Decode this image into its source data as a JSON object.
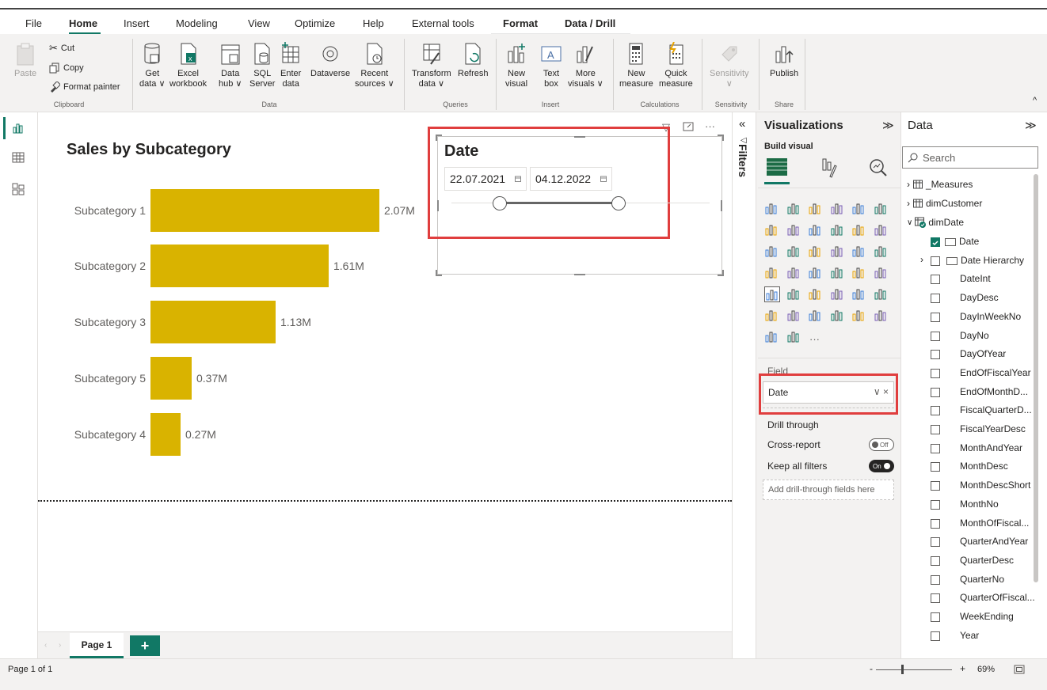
{
  "menu": {
    "tabs": [
      "File",
      "Home",
      "Insert",
      "Modeling",
      "View",
      "Optimize",
      "Help",
      "External tools",
      "Format",
      "Data / Drill"
    ],
    "active": "Home"
  },
  "ribbon": {
    "clipboard": {
      "paste": "Paste",
      "cut": "Cut",
      "copy": "Copy",
      "format_painter": "Format painter",
      "group": "Clipboard"
    },
    "data": {
      "get_data": [
        "Get",
        "data ∨"
      ],
      "excel": [
        "Excel",
        "workbook"
      ],
      "data_hub": [
        "Data",
        "hub ∨"
      ],
      "sql": [
        "SQL",
        "Server"
      ],
      "enter": [
        "Enter",
        "data"
      ],
      "dataverse": "Dataverse",
      "recent": [
        "Recent",
        "sources ∨"
      ],
      "group": "Data"
    },
    "queries": {
      "transform": [
        "Transform",
        "data ∨"
      ],
      "refresh": "Refresh",
      "group": "Queries"
    },
    "insert": {
      "new_visual": [
        "New",
        "visual"
      ],
      "text_box": [
        "Text",
        "box"
      ],
      "more_visuals": [
        "More",
        "visuals ∨"
      ],
      "group": "Insert"
    },
    "calculations": {
      "new_measure": [
        "New",
        "measure"
      ],
      "quick_measure": [
        "Quick",
        "measure"
      ],
      "group": "Calculations"
    },
    "sensitivity": {
      "label": "Sensitivity",
      "chev": "∨",
      "group": "Sensitivity"
    },
    "share": {
      "publish": "Publish",
      "group": "Share"
    }
  },
  "chart_data": {
    "type": "bar",
    "title": "Sales by Subcategory",
    "categories": [
      "Subcategory 1",
      "Subcategory 2",
      "Subcategory 3",
      "Subcategory 5",
      "Subcategory 4"
    ],
    "values": [
      2.07,
      1.61,
      1.13,
      0.37,
      0.27
    ],
    "labels": [
      "2.07M",
      "1.61M",
      "1.13M",
      "0.37M",
      "0.27M"
    ],
    "orientation": "horizontal",
    "color": "#d9b300"
  },
  "slicer": {
    "title": "Date",
    "start": "22.07.2021",
    "end": "04.12.2022",
    "more": "···"
  },
  "filters": {
    "label": "Filters",
    "collapse": "«",
    "icon": "◁"
  },
  "visualizations": {
    "title": "Visualizations",
    "expand": "≫",
    "build_visual": "Build visual",
    "field_label": "Field",
    "field_value": "Date",
    "field_actions": "∨ ×",
    "drill_through": "Drill through",
    "cross_report": "Cross-report",
    "cross_report_state": "Off",
    "keep_all_filters": "Keep all filters",
    "keep_all_filters_state": "On",
    "add_drill": "Add drill-through fields here",
    "more": "···"
  },
  "data_pane": {
    "title": "Data",
    "expand": "≫",
    "search_placeholder": "Search",
    "tables": [
      "_Measures",
      "dimCustomer",
      "dimDate"
    ],
    "fields": [
      "Date",
      "Date Hierarchy",
      "DateInt",
      "DayDesc",
      "DayInWeekNo",
      "DayNo",
      "DayOfYear",
      "EndOfFiscalYear",
      "EndOfMonthD...",
      "FiscalQuarterD...",
      "FiscalYearDesc",
      "MonthAndYear",
      "MonthDesc",
      "MonthDescShort",
      "MonthNo",
      "MonthOfFiscal...",
      "QuarterAndYear",
      "QuarterDesc",
      "QuarterNo",
      "QuarterOfFiscal...",
      "WeekEnding",
      "Year"
    ]
  },
  "pages": {
    "current": "Page 1",
    "add": "+"
  },
  "status": {
    "page_info": "Page 1 of 1",
    "zoom": "69%",
    "minus": "-",
    "plus": "+"
  }
}
